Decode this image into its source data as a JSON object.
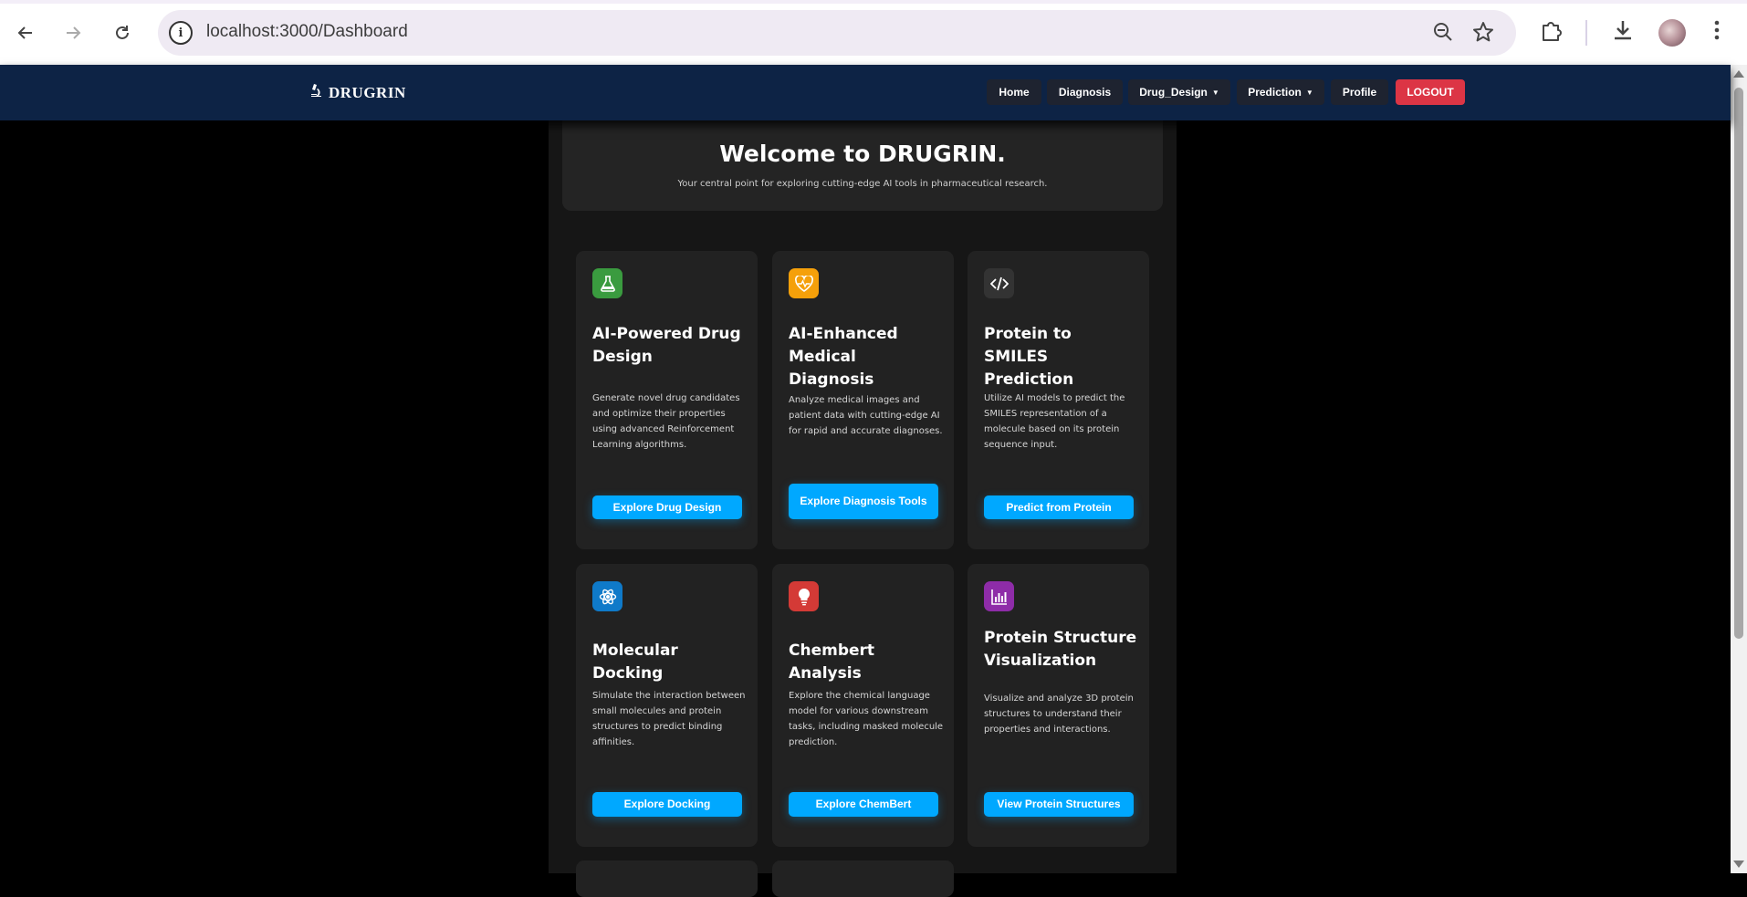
{
  "browser": {
    "url": "localhost:3000/Dashboard",
    "icons": {
      "back": "back-arrow-icon",
      "forward": "forward-arrow-icon",
      "reload": "reload-icon",
      "zoom": "zoom-out-icon",
      "bookmark": "star-icon",
      "extensions": "puzzle-icon",
      "download": "download-icon",
      "menu": "kebab-menu-icon"
    }
  },
  "navbar": {
    "brand": "DRUGRIN",
    "items": [
      "Home",
      "Diagnosis",
      "Drug_Design",
      "Prediction",
      "Profile"
    ],
    "logout": "LOGOUT"
  },
  "hero": {
    "title": "Welcome to DRUGRIN.",
    "subtitle": "Your central point for exploring cutting-edge AI tools in pharmaceutical research."
  },
  "cards": [
    {
      "icon": "flask-icon",
      "color": "#3a9b3f",
      "title": "AI-Powered Drug Design",
      "description": "Generate novel drug candidates and optimize their properties using advanced Reinforcement Learning algorithms.",
      "button": "Explore Drug Design"
    },
    {
      "icon": "heart-pulse-icon",
      "color": "#f5a00a",
      "title": "AI-Enhanced Medical Diagnosis",
      "description": "Analyze medical images and patient data with cutting-edge AI for rapid and accurate diagnoses.",
      "button": "Explore Diagnosis Tools"
    },
    {
      "icon": "code-icon",
      "color": "#333333",
      "title": "Protein to SMILES Prediction",
      "description": "Utilize AI models to predict the SMILES representation of a molecule based on its protein sequence input.",
      "button": "Predict from Protein"
    },
    {
      "icon": "atom-icon",
      "color": "#0f7ac9",
      "title": "Molecular Docking",
      "description": "Simulate the interaction between small molecules and protein structures to predict binding affinities.",
      "button": "Explore Docking"
    },
    {
      "icon": "lightbulb-icon",
      "color": "#d43a36",
      "title": "Chembert Analysis",
      "description": "Explore the chemical language model for various downstream tasks, including masked molecule prediction.",
      "button": "Explore ChemBert"
    },
    {
      "icon": "bar-chart-icon",
      "color": "#8e2ca8",
      "title": "Protein Structure Visualization",
      "description": "Visualize and analyze 3D protein structures to understand their properties and interactions.",
      "button": "View Protein Structures"
    }
  ]
}
